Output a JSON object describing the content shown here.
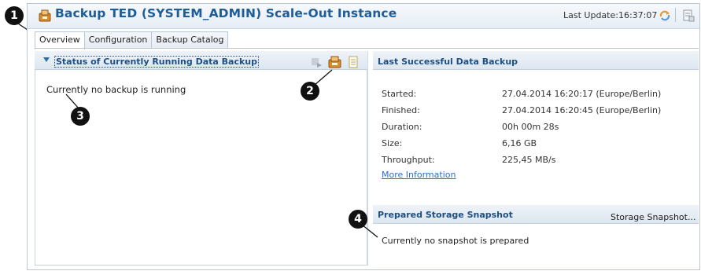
{
  "window": {
    "title": "Backup TED (SYSTEM_ADMIN) Scale-Out Instance",
    "last_update": "Last Update:16:37:07"
  },
  "tabs": [
    {
      "label": "Overview",
      "active": true
    },
    {
      "label": "Configuration",
      "active": false
    },
    {
      "label": "Backup Catalog",
      "active": false
    }
  ],
  "running_backup": {
    "title": "Status of Currently Running Data Backup",
    "status": "Currently no backup is running"
  },
  "last_backup": {
    "title": "Last Successful Data Backup",
    "fields": [
      {
        "label": "Started:",
        "value": "27.04.2014 16:20:17 (Europe/Berlin)"
      },
      {
        "label": "Finished:",
        "value": "27.04.2014 16:20:45 (Europe/Berlin)"
      },
      {
        "label": "Duration:",
        "value": "00h 00m 28s"
      },
      {
        "label": "Size:",
        "value": "6,16 GB"
      },
      {
        "label": "Throughput:",
        "value": "225,45 MB/s"
      }
    ],
    "more_link": "More Information"
  },
  "snapshot": {
    "title": "Prepared Storage Snapshot",
    "action": "Storage Snapshot...",
    "status": "Currently no snapshot is prepared"
  },
  "markers": [
    "1",
    "2",
    "3",
    "4"
  ],
  "icons": {
    "title": "backup-icon",
    "refresh": "refresh-icon",
    "open": "open-editor-icon",
    "disabled_action": "cancel-backup-icon",
    "start_backup": "start-backup-icon",
    "log": "backup-log-icon"
  },
  "colors": {
    "title": "#1e5c9a",
    "section_title": "#1e4f84",
    "link": "#2c6fc1"
  }
}
